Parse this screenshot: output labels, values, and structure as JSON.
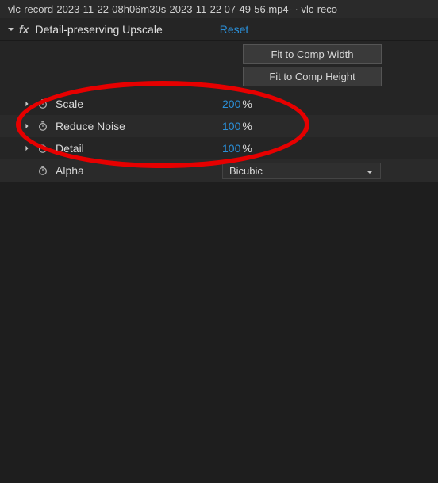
{
  "titleBar": "vlc-record-2023-11-22-08h06m30s-2023-11-22 07-49-56.mp4- · vlc-reco",
  "effect": {
    "name": "Detail-preserving Upscale",
    "resetLabel": "Reset"
  },
  "fitButtons": {
    "width": "Fit to Comp Width",
    "height": "Fit to Comp Height"
  },
  "props": {
    "scale": {
      "label": "Scale",
      "value": "200",
      "unit": "%"
    },
    "reduceNoise": {
      "label": "Reduce Noise",
      "value": "100",
      "unit": "%"
    },
    "detail": {
      "label": "Detail",
      "value": "100",
      "unit": "%"
    },
    "alpha": {
      "label": "Alpha",
      "selected": "Bicubic"
    }
  }
}
